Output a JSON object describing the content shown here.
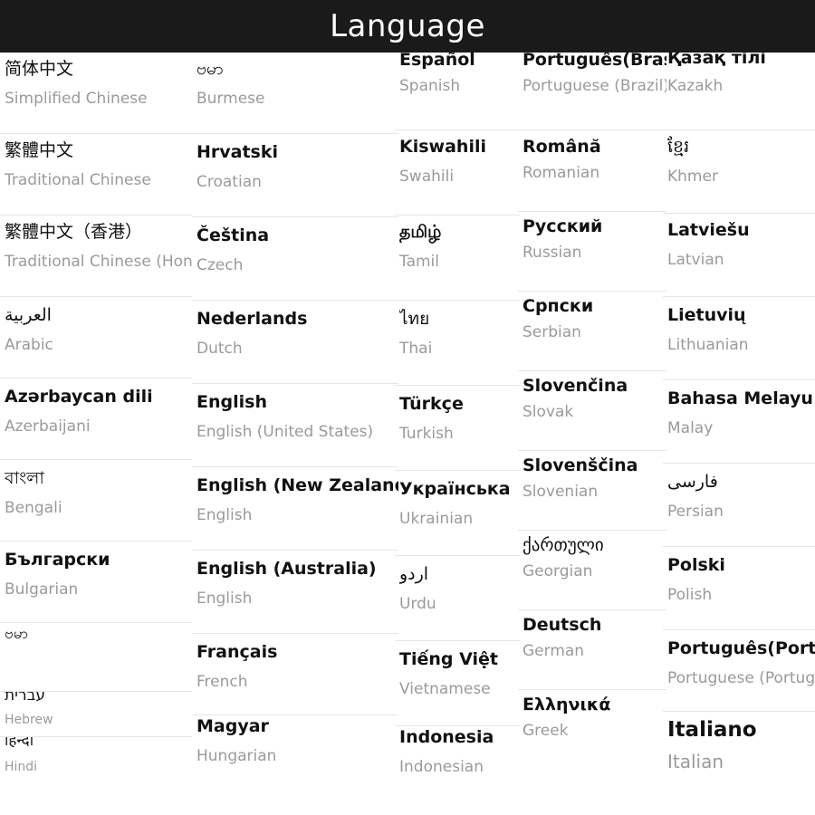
{
  "header": {
    "title": "Language"
  },
  "columns": [
    {
      "items": [
        {
          "name": "简体中文",
          "sub": "Simplified Chinese"
        },
        {
          "name": "繁體中文",
          "sub": "Traditional Chinese"
        },
        {
          "name": "繁體中文（香港）",
          "sub": "Traditional Chinese (Hong"
        },
        {
          "name": "العربية",
          "sub": "Arabic"
        },
        {
          "name": "Azərbaycan dili",
          "sub": "Azerbaijani"
        },
        {
          "name": "বাংলা",
          "sub": "Bengali"
        },
        {
          "name": "Български",
          "sub": "Bulgarian"
        },
        {
          "name": "ဗမာ",
          "sub": ""
        },
        {
          "name": "עברית",
          "sub": "Hebrew"
        },
        {
          "name": "हिन्दी",
          "sub": "Hindi"
        }
      ]
    },
    {
      "items": [
        {
          "name": "ဗမာ",
          "sub": "Burmese"
        },
        {
          "name": "Hrvatski",
          "sub": "Croatian"
        },
        {
          "name": "Čeština",
          "sub": "Czech"
        },
        {
          "name": "Nederlands",
          "sub": "Dutch"
        },
        {
          "name": "English",
          "sub": "English (United States)"
        },
        {
          "name": "English (New Zealand)",
          "sub": "English"
        },
        {
          "name": "English (Australia)",
          "sub": "English"
        },
        {
          "name": "Français",
          "sub": "French"
        },
        {
          "name": "Magyar",
          "sub": "Hungarian"
        }
      ]
    },
    {
      "items": [
        {
          "name": "Español",
          "sub": "Spanish"
        },
        {
          "name": "Kiswahili",
          "sub": "Swahili"
        },
        {
          "name": "தமிழ்",
          "sub": "Tamil"
        },
        {
          "name": "ไทย",
          "sub": "Thai"
        },
        {
          "name": "Türkçe",
          "sub": "Turkish"
        },
        {
          "name": "Українська",
          "sub": "Ukrainian"
        },
        {
          "name": "اردو",
          "sub": "Urdu"
        },
        {
          "name": "Tiếng Việt",
          "sub": "Vietnamese"
        },
        {
          "name": "Indonesia",
          "sub": "Indonesian"
        }
      ]
    },
    {
      "items": [
        {
          "name": "Português(Brasil)",
          "sub": "Portuguese (Brazil)"
        },
        {
          "name": "Română",
          "sub": "Romanian"
        },
        {
          "name": "Русский",
          "sub": "Russian"
        },
        {
          "name": "Српски",
          "sub": "Serbian"
        },
        {
          "name": "Slovenčina",
          "sub": "Slovak"
        },
        {
          "name": "Slovenščina",
          "sub": "Slovenian"
        },
        {
          "name": "ქართული",
          "sub": "Georgian"
        },
        {
          "name": "Deutsch",
          "sub": "German"
        },
        {
          "name": "Ελληνικά",
          "sub": "Greek"
        }
      ]
    },
    {
      "items": [
        {
          "name": "Қазақ тілі",
          "sub": "Kazakh"
        },
        {
          "name": "ខ្មែរ",
          "sub": "Khmer"
        },
        {
          "name": "Latviešu",
          "sub": "Latvian"
        },
        {
          "name": "Lietuvių",
          "sub": "Lithuanian"
        },
        {
          "name": "Bahasa Melayu",
          "sub": "Malay"
        },
        {
          "name": "فارسی",
          "sub": "Persian"
        },
        {
          "name": "Polski",
          "sub": "Polish"
        },
        {
          "name": "Português(Portugal)",
          "sub": "Portuguese (Portugal)"
        },
        {
          "name": "Italiano",
          "sub": "Italian"
        }
      ]
    }
  ]
}
